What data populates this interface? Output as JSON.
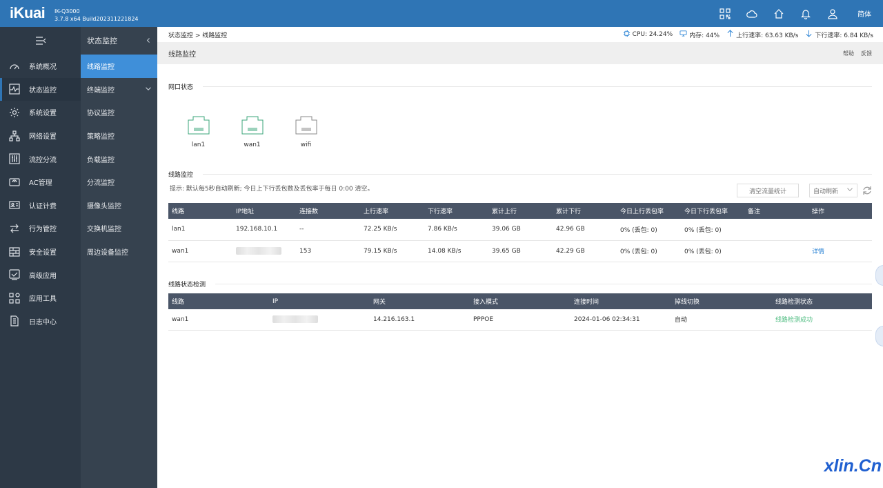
{
  "header": {
    "logo": "iKuai",
    "model": "IK-Q3000",
    "version": "3.7.8 x64 Build202311221824",
    "icons": [
      "qrcode-icon",
      "cloud-icon",
      "home-icon",
      "bell-icon",
      "user-icon"
    ],
    "language": "简体"
  },
  "sidebar": {
    "items": [
      {
        "label": "系统概况",
        "icon": "gauge-icon"
      },
      {
        "label": "状态监控",
        "icon": "monitor-icon"
      },
      {
        "label": "系统设置",
        "icon": "gear-icon"
      },
      {
        "label": "网络设置",
        "icon": "network-icon"
      },
      {
        "label": "流控分流",
        "icon": "sliders-icon"
      },
      {
        "label": "AC管理",
        "icon": "ap-icon"
      },
      {
        "label": "认证计费",
        "icon": "id-card-icon"
      },
      {
        "label": "行为管控",
        "icon": "arrows-icon"
      },
      {
        "label": "安全设置",
        "icon": "firewall-icon"
      },
      {
        "label": "高级应用",
        "icon": "check-box-icon"
      },
      {
        "label": "应用工具",
        "icon": "tools-icon"
      },
      {
        "label": "日志中心",
        "icon": "log-icon"
      }
    ]
  },
  "subnav": {
    "title": "状态监控",
    "items": [
      "线路监控",
      "终端监控",
      "协议监控",
      "策略监控",
      "负载监控",
      "分流监控",
      "摄像头监控",
      "交换机监控",
      "周边设备监控"
    ]
  },
  "breadcrumb": "状态监控 > 线路监控",
  "stats": {
    "cpu": "CPU: 24.24%",
    "mem": "内存: 44%",
    "up": "上行速率: 63.63 KB/s",
    "down": "下行速率: 6.84 KB/s"
  },
  "page": {
    "title": "线路监控",
    "help": "帮助",
    "feedback": "反馈"
  },
  "port_section": {
    "title": "网口状态",
    "ports": [
      {
        "name": "lan1",
        "color": "#3aa57a"
      },
      {
        "name": "wan1",
        "color": "#3aa57a"
      },
      {
        "name": "wifi",
        "color": "#888888"
      }
    ]
  },
  "line_monitor": {
    "title": "线路监控",
    "hint": "提示: 默认每5秒自动刷新; 今日上下行丢包数及丢包率于每日 0:00 清空。",
    "clear_button": "清空流量统计",
    "refresh_select": "自动刷新",
    "columns": [
      "线路",
      "IP地址",
      "连接数",
      "上行速率",
      "下行速率",
      "累计上行",
      "累计下行",
      "今日上行丢包率",
      "今日下行丢包率",
      "备注",
      "操作"
    ],
    "rows": [
      {
        "line": "lan1",
        "ip": "192.168.10.1",
        "conn": "--",
        "up": "72.25 KB/s",
        "down": "7.86 KB/s",
        "total_up": "39.06 GB",
        "total_down": "42.96 GB",
        "loss_up": "0% (丢包: 0)",
        "loss_down": "0% (丢包: 0)",
        "note": "",
        "action": ""
      },
      {
        "line": "wan1",
        "ip": "",
        "conn": "153",
        "up": "79.15 KB/s",
        "down": "14.08 KB/s",
        "total_up": "39.65 GB",
        "total_down": "42.29 GB",
        "loss_up": "0% (丢包: 0)",
        "loss_down": "0% (丢包: 0)",
        "note": "",
        "action": "详情"
      }
    ]
  },
  "line_check": {
    "title": "线路状态检测",
    "columns": [
      "线路",
      "IP",
      "网关",
      "接入模式",
      "连接时间",
      "掉线切换",
      "线路检测状态"
    ],
    "rows": [
      {
        "line": "wan1",
        "ip": "",
        "gateway": "14.216.163.1",
        "mode": "PPPOE",
        "time": "2024-01-06 02:34:31",
        "switch": "自动",
        "status": "线路检测成功"
      }
    ]
  },
  "watermark": "xlin.Cn"
}
